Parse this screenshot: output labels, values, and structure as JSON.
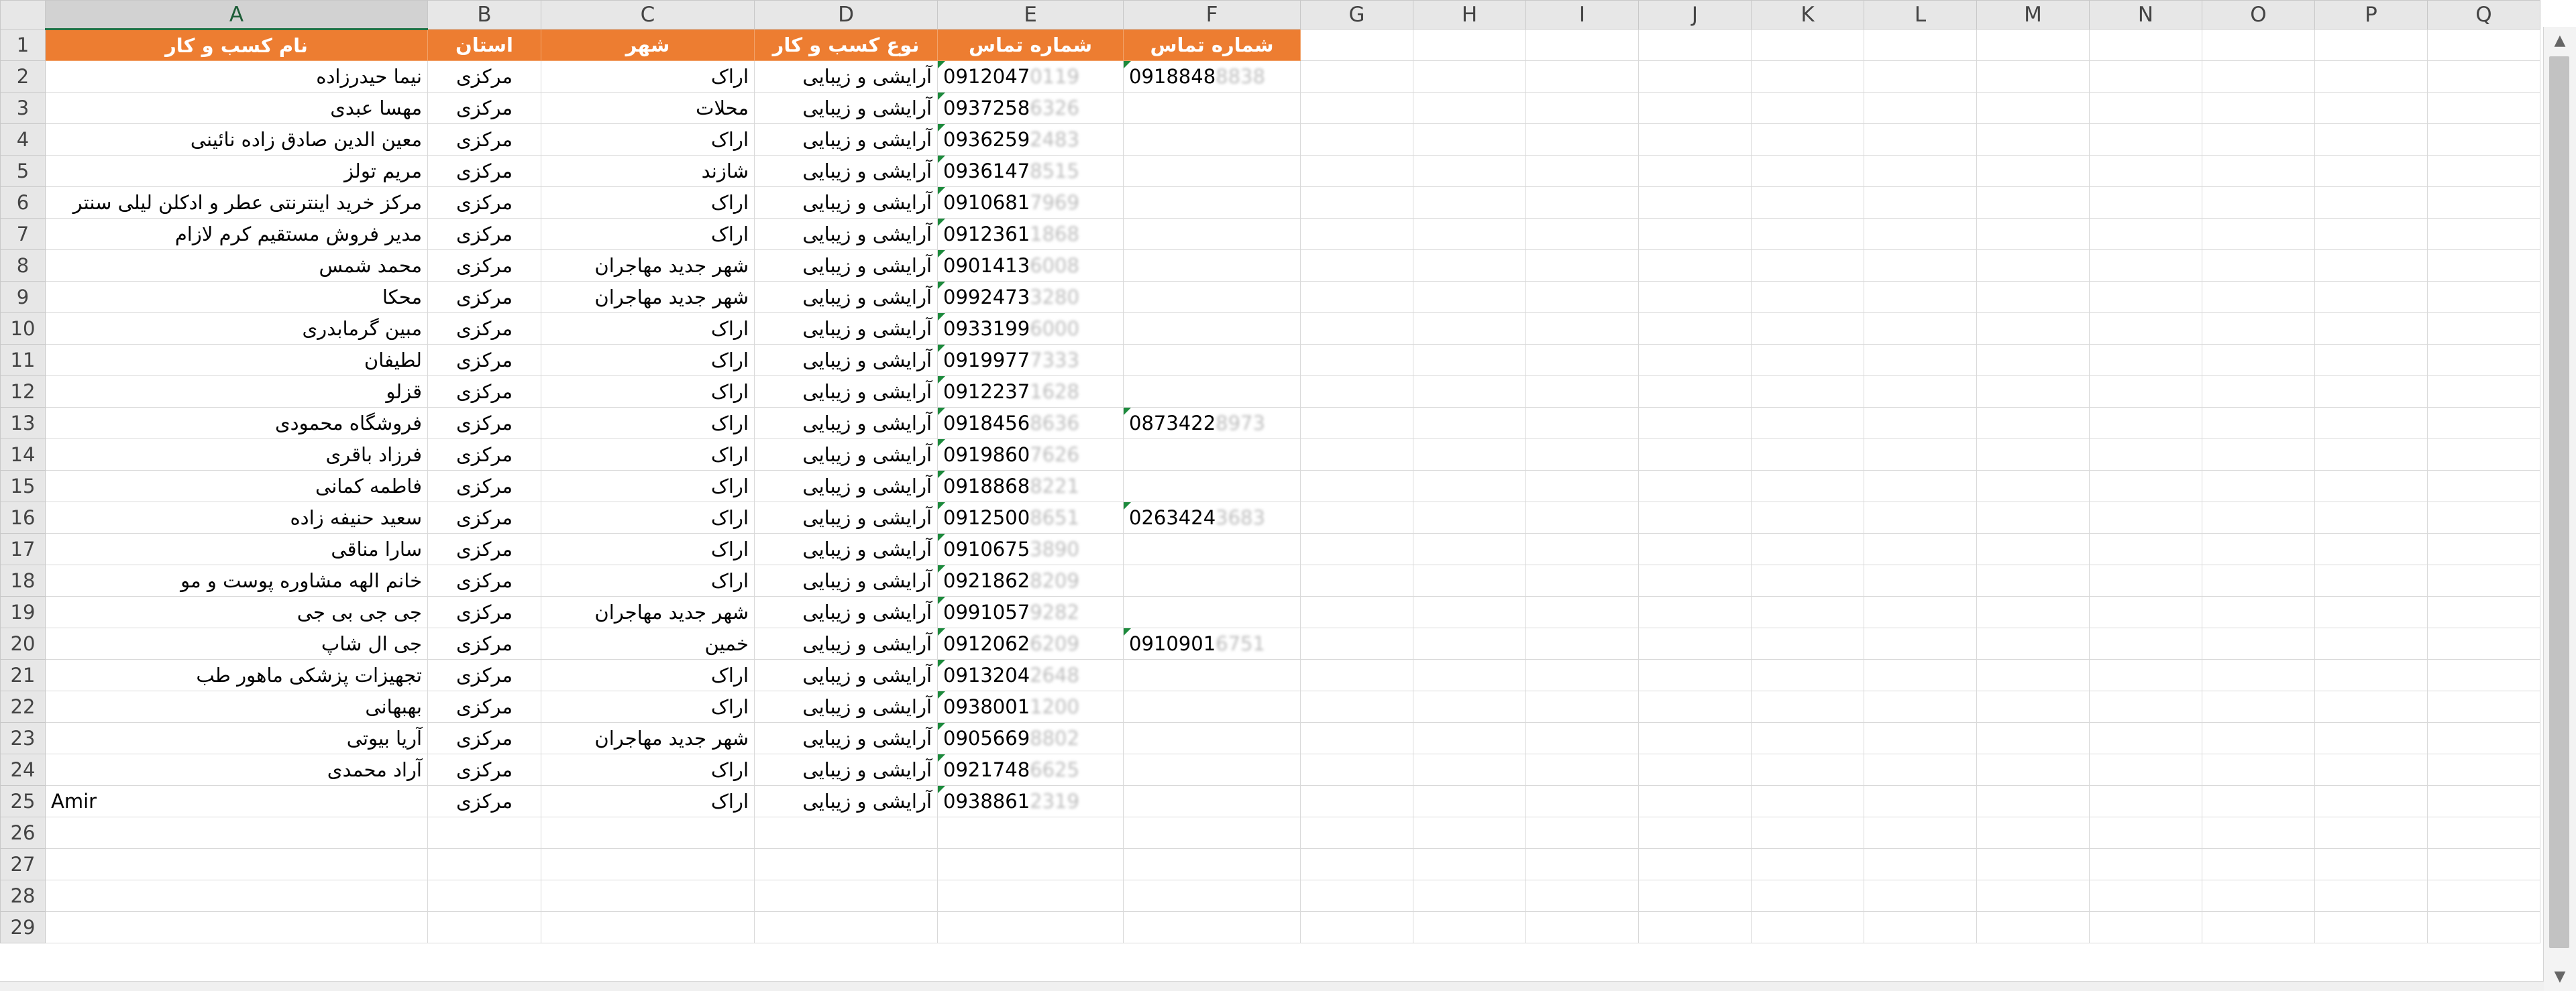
{
  "columns": [
    "A",
    "B",
    "C",
    "D",
    "E",
    "F",
    "G",
    "H",
    "I",
    "J",
    "K",
    "L",
    "M",
    "N",
    "O",
    "P",
    "Q"
  ],
  "header": {
    "A": "نام کسب و کار",
    "B": "استان",
    "C": "شهر",
    "D": "نوع کسب و کار",
    "E": "شماره تماس",
    "F": "شماره تماس"
  },
  "rows": [
    {
      "n": "2",
      "name": "نیما حیدرزاده",
      "province": "مرکزی",
      "city": "اراک",
      "type": "آرایشی و زیبایی",
      "phone": "0912047",
      "phone_hidden": "0119",
      "phone2": "0918848",
      "phone2_hidden": "8838"
    },
    {
      "n": "3",
      "name": "مهسا عبدی",
      "province": "مرکزی",
      "city": "محلات",
      "type": "آرایشی و زیبایی",
      "phone": "0937258",
      "phone_hidden": "6326",
      "phone2": "",
      "phone2_hidden": ""
    },
    {
      "n": "4",
      "name": "معین الدین صادق زاده نائینی",
      "province": "مرکزی",
      "city": "اراک",
      "type": "آرایشی و زیبایی",
      "phone": "0936259",
      "phone_hidden": "2483",
      "phone2": "",
      "phone2_hidden": ""
    },
    {
      "n": "5",
      "name": "مریم تولز",
      "province": "مرکزی",
      "city": "شازند",
      "type": "آرایشی و زیبایی",
      "phone": "0936147",
      "phone_hidden": "8515",
      "phone2": "",
      "phone2_hidden": ""
    },
    {
      "n": "6",
      "name": "مرکز خرید اینترنتی عطر و ادکلن لیلی سنتر",
      "province": "مرکزی",
      "city": "اراک",
      "type": "آرایشی و زیبایی",
      "phone": "0910681",
      "phone_hidden": "7969",
      "phone2": "",
      "phone2_hidden": ""
    },
    {
      "n": "7",
      "name": "مدیر فروش مستقیم کرم لازام",
      "province": "مرکزی",
      "city": "اراک",
      "type": "آرایشی و زیبایی",
      "phone": "0912361",
      "phone_hidden": "1868",
      "phone2": "",
      "phone2_hidden": ""
    },
    {
      "n": "8",
      "name": "محمد شمس",
      "province": "مرکزی",
      "city": "شهر جدید مهاجران",
      "type": "آرایشی و زیبایی",
      "phone": "0901413",
      "phone_hidden": "6008",
      "phone2": "",
      "phone2_hidden": ""
    },
    {
      "n": "9",
      "name": "محکا",
      "province": "مرکزی",
      "city": "شهر جدید مهاجران",
      "type": "آرایشی و زیبایی",
      "phone": "0992473",
      "phone_hidden": "3280",
      "phone2": "",
      "phone2_hidden": ""
    },
    {
      "n": "10",
      "name": "مبین گرمابدری",
      "province": "مرکزی",
      "city": "اراک",
      "type": "آرایشی و زیبایی",
      "phone": "0933199",
      "phone_hidden": "6000",
      "phone2": "",
      "phone2_hidden": ""
    },
    {
      "n": "11",
      "name": "لطیفان",
      "province": "مرکزی",
      "city": "اراک",
      "type": "آرایشی و زیبایی",
      "phone": "0919977",
      "phone_hidden": "7333",
      "phone2": "",
      "phone2_hidden": ""
    },
    {
      "n": "12",
      "name": "قزلو",
      "province": "مرکزی",
      "city": "اراک",
      "type": "آرایشی و زیبایی",
      "phone": "0912237",
      "phone_hidden": "1628",
      "phone2": "",
      "phone2_hidden": ""
    },
    {
      "n": "13",
      "name": "فروشگاه محمودی",
      "province": "مرکزی",
      "city": "اراک",
      "type": "آرایشی و زیبایی",
      "phone": "0918456",
      "phone_hidden": "8636",
      "phone2": "0873422",
      "phone2_hidden": "8973"
    },
    {
      "n": "14",
      "name": "فرزاد باقری",
      "province": "مرکزی",
      "city": "اراک",
      "type": "آرایشی و زیبایی",
      "phone": "0919860",
      "phone_hidden": "7626",
      "phone2": "",
      "phone2_hidden": ""
    },
    {
      "n": "15",
      "name": "فاطمه کمانی",
      "province": "مرکزی",
      "city": "اراک",
      "type": "آرایشی و زیبایی",
      "phone": "0918868",
      "phone_hidden": "8221",
      "phone2": "",
      "phone2_hidden": ""
    },
    {
      "n": "16",
      "name": "سعید حنیفه زاده",
      "province": "مرکزی",
      "city": "اراک",
      "type": "آرایشی و زیبایی",
      "phone": "0912500",
      "phone_hidden": "8651",
      "phone2": "0263424",
      "phone2_hidden": "3683"
    },
    {
      "n": "17",
      "name": "سارا مناقی",
      "province": "مرکزی",
      "city": "اراک",
      "type": "آرایشی و زیبایی",
      "phone": "0910675",
      "phone_hidden": "3890",
      "phone2": "",
      "phone2_hidden": ""
    },
    {
      "n": "18",
      "name": "خانم الهه مشاوره پوست و مو",
      "province": "مرکزی",
      "city": "اراک",
      "type": "آرایشی و زیبایی",
      "phone": "0921862",
      "phone_hidden": "8209",
      "phone2": "",
      "phone2_hidden": ""
    },
    {
      "n": "19",
      "name": "جی جی بی جی",
      "province": "مرکزی",
      "city": "شهر جدید مهاجران",
      "type": "آرایشی و زیبایی",
      "phone": "0991057",
      "phone_hidden": "9282",
      "phone2": "",
      "phone2_hidden": ""
    },
    {
      "n": "20",
      "name": "جی ال شاپ",
      "province": "مرکزی",
      "city": "خمین",
      "type": "آرایشی و زیبایی",
      "phone": "0912062",
      "phone_hidden": "6209",
      "phone2": "0910901",
      "phone2_hidden": "6751"
    },
    {
      "n": "21",
      "name": "تجهیزات پزشکی ماهور طب",
      "province": "مرکزی",
      "city": "اراک",
      "type": "آرایشی و زیبایی",
      "phone": "0913204",
      "phone_hidden": "2648",
      "phone2": "",
      "phone2_hidden": ""
    },
    {
      "n": "22",
      "name": "بهبهانی",
      "province": "مرکزی",
      "city": "اراک",
      "type": "آرایشی و زیبایی",
      "phone": "0938001",
      "phone_hidden": "1200",
      "phone2": "",
      "phone2_hidden": ""
    },
    {
      "n": "23",
      "name": "آریا بیوتی",
      "province": "مرکزی",
      "city": "شهر جدید مهاجران",
      "type": "آرایشی و زیبایی",
      "phone": "0905669",
      "phone_hidden": "8802",
      "phone2": "",
      "phone2_hidden": ""
    },
    {
      "n": "24",
      "name": "آراد محمدی",
      "province": "مرکزی",
      "city": "اراک",
      "type": "آرایشی و زیبایی",
      "phone": "0921748",
      "phone_hidden": "6625",
      "phone2": "",
      "phone2_hidden": ""
    },
    {
      "n": "25",
      "name": "Amir",
      "province": "مرکزی",
      "city": "اراک",
      "type": "آرایشی و زیبایی",
      "phone": "0938861",
      "phone_hidden": "2319",
      "phone2": "",
      "phone2_hidden": ""
    }
  ],
  "empty_rows": [
    "26",
    "27",
    "28",
    "29"
  ],
  "colors": {
    "header_fill": "#ed7d31",
    "header_text": "#ffffff",
    "selection": "#217346",
    "comment_marker": "#1c8a3c"
  },
  "icons": {
    "scroll_up": "▲",
    "scroll_down": "▼"
  }
}
